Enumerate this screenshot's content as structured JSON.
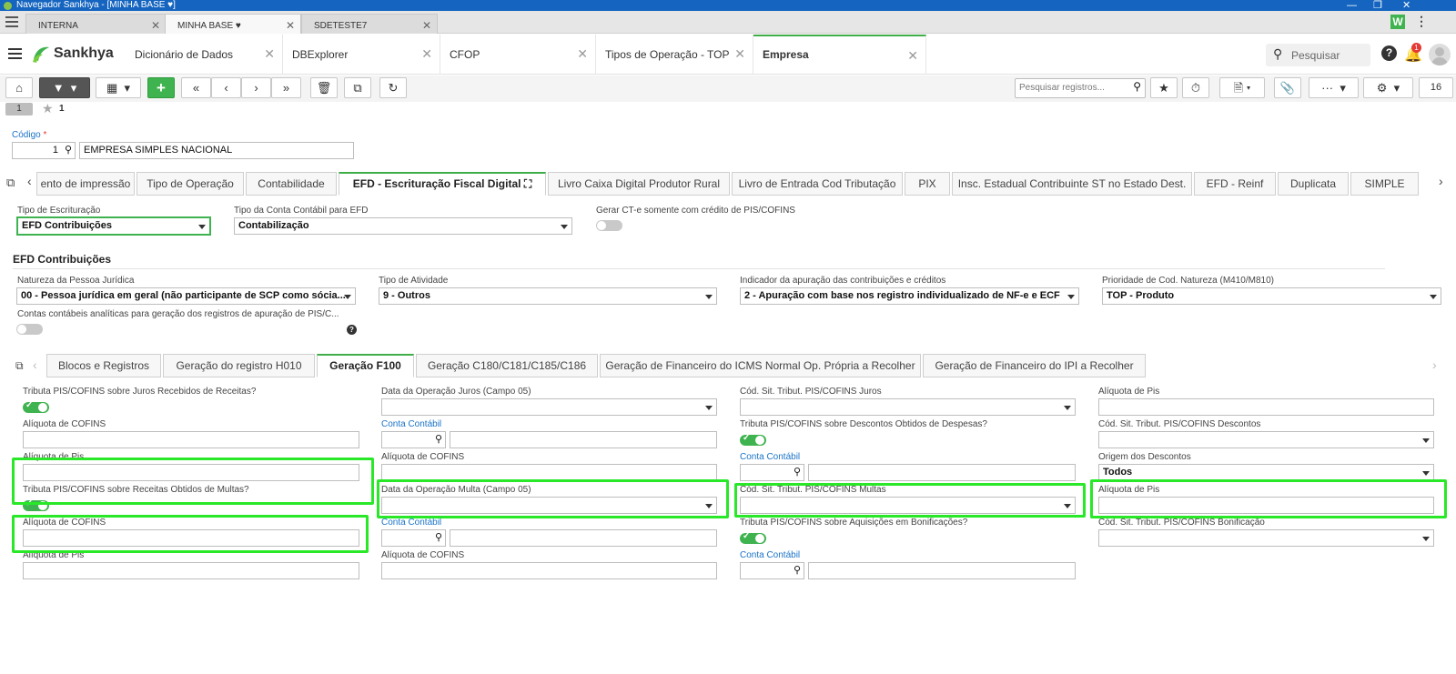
{
  "window": {
    "title": "Navegador Sankhya - [MINHA BASE ♥]"
  },
  "browser_tabs": [
    "INTERNA",
    "MINHA BASE ♥",
    "SDETESTE7"
  ],
  "app": {
    "brand": "Sankhya",
    "tabs": [
      "Dicionário de Dados",
      "DBExplorer",
      "CFOP",
      "Tipos de Operação - TOP",
      "Empresa"
    ],
    "search_placeholder": "Pesquisar",
    "notif_count": "1"
  },
  "toolbar": {
    "search_placeholder": "Pesquisar registros...",
    "page": "16"
  },
  "record": {
    "badge": "1",
    "fav": "1",
    "codigo_label": "Código",
    "required": "*",
    "codigo_value": "1",
    "empresa_name": "EMPRESA SIMPLES NACIONAL"
  },
  "main_tabs": [
    "ento de impressão",
    "Tipo de Operação",
    "Contabilidade",
    "EFD - Escrituração Fiscal Digital",
    "Livro Caixa Digital Produtor Rural",
    "Livro de Entrada Cod Tributação",
    "PIX",
    "Insc. Estadual Contribuinte ST no Estado Dest.",
    "EFD - Reinf",
    "Duplicata",
    "SIMPLE"
  ],
  "efd": {
    "tipo_escrituracao_label": "Tipo de Escrituração",
    "tipo_escrituracao_value": "EFD Contribuições",
    "tipo_conta_label": "Tipo da Conta Contábil para EFD",
    "tipo_conta_value": "Contabilização",
    "gerar_cte_label": "Gerar CT-e somente com crédito de PIS/COFINS",
    "section_title": "EFD Contribuições",
    "natureza_label": "Natureza da Pessoa Jurídica",
    "natureza_value": "00 - Pessoa jurídica em geral (não participante de SCP como sócia...",
    "atividade_label": "Tipo de Atividade",
    "atividade_value": "9 - Outros",
    "indicador_label": "Indicador da apuração das contribuições e créditos",
    "indicador_value": "2 - Apuração com base nos registro individualizado de NF-e e ECF",
    "prioridade_label": "Prioridade de Cod. Natureza (M410/M810)",
    "prioridade_value": "TOP - Produto",
    "contas_label": "Contas contábeis analíticas para geração dos registros de apuração de PIS/C..."
  },
  "sub_tabs": [
    "Blocos e Registros",
    "Geração do registro H010",
    "Geração F100",
    "Geração C180/C181/C185/C186",
    "Geração de Financeiro do ICMS Normal Op. Própria a Recolher",
    "Geração de Financeiro do IPI a Recolher"
  ],
  "f100": {
    "c1": {
      "l1": "Tributa PIS/COFINS sobre Juros Recebidos de Receitas?",
      "l2": "Alíquota de COFINS",
      "l3": "Alíquota de Pis",
      "l4": "Tributa PIS/COFINS sobre Receitas Obtidos de Multas?",
      "l5": "Alíquota de COFINS",
      "l6": "Alíquota de Pis"
    },
    "c2": {
      "l1": "Data da Operação Juros (Campo 05)",
      "l2": "Conta Contábil",
      "l3": "Alíquota de COFINS",
      "l4": "Data da Operação Multa (Campo 05)",
      "l5": "Conta Contábil",
      "l6": "Alíquota de COFINS"
    },
    "c3": {
      "l1": "Cód. Sit. Tribut. PIS/COFINS Juros",
      "l2": "Tributa PIS/COFINS sobre Descontos Obtidos de Despesas?",
      "l3": "Conta Contábil",
      "l4": "Cód. Sit. Tribut. PIS/COFINS Multas",
      "l5": "Tributa PIS/COFINS sobre Aquisições em Bonificações?",
      "l6": "Conta Contábil"
    },
    "c4": {
      "l1": "Alíquota de Pis",
      "l2": "Cód. Sit. Tribut. PIS/COFINS Descontos",
      "l3": "Origem dos Descontos",
      "l3_value": "Todos",
      "l4": "Alíquota de Pis",
      "l5": "Cód. Sit. Tribut. PIS/COFINS Bonificação"
    }
  }
}
